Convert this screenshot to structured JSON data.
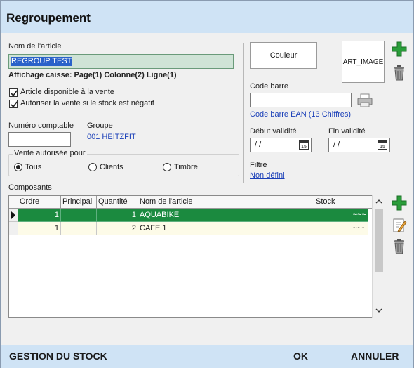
{
  "window": {
    "title": "Regroupement"
  },
  "article": {
    "name_label": "Nom de l'article",
    "name_value": "REGROUP TEST",
    "affichage_caisse": "Affichage caisse: Page(1) Colonne(2) Ligne(1)",
    "chk_disponible": "Article disponible à la vente",
    "chk_stock_negatif": "Autoriser la vente si le stock est négatif",
    "numero_label": "Numéro comptable",
    "numero_value": "",
    "groupe_label": "Groupe",
    "groupe_value": "001 HEITZFIT"
  },
  "vente": {
    "legend": "Vente autorisée pour",
    "options": [
      "Tous",
      "Clients",
      "Timbre"
    ],
    "selected": "Tous"
  },
  "right": {
    "couleur_button": "Couleur",
    "image_text": "ART_IMAGE",
    "code_barre_label": "Code barre",
    "code_barre_value": "",
    "code_barre_link": "Code barre EAN (13 Chiffres)",
    "debut_label": "Début validité",
    "debut_value": "/ /",
    "fin_label": "Fin validité",
    "fin_value": "/ /",
    "filtre_label": "Filtre",
    "filtre_link": "Non défini"
  },
  "composants": {
    "label": "Composants",
    "columns": [
      "Ordre",
      "Principal",
      "Quantité",
      "Nom de l'article",
      "Stock"
    ],
    "rows": [
      {
        "ordre": "1",
        "principal": "",
        "quantite": "1",
        "nom": "AQUABIKE",
        "stock": "~~~"
      },
      {
        "ordre": "1",
        "principal": "",
        "quantite": "2",
        "nom": "CAFE 1",
        "stock": "~~~"
      }
    ]
  },
  "footer": {
    "gestion": "GESTION DU STOCK",
    "ok": "OK",
    "annuler": "ANNULER"
  },
  "colors": {
    "title_bar": "#cfe3f5",
    "selected_row": "#1b8a3f",
    "link": "#1a3fb8",
    "focused_input": "#cfe3d6"
  },
  "icons": [
    "add-icon",
    "delete-icon",
    "printer-icon",
    "calendar-icon",
    "edit-icon",
    "row-pointer-icon",
    "scroll-up-icon",
    "scroll-down-icon"
  ]
}
